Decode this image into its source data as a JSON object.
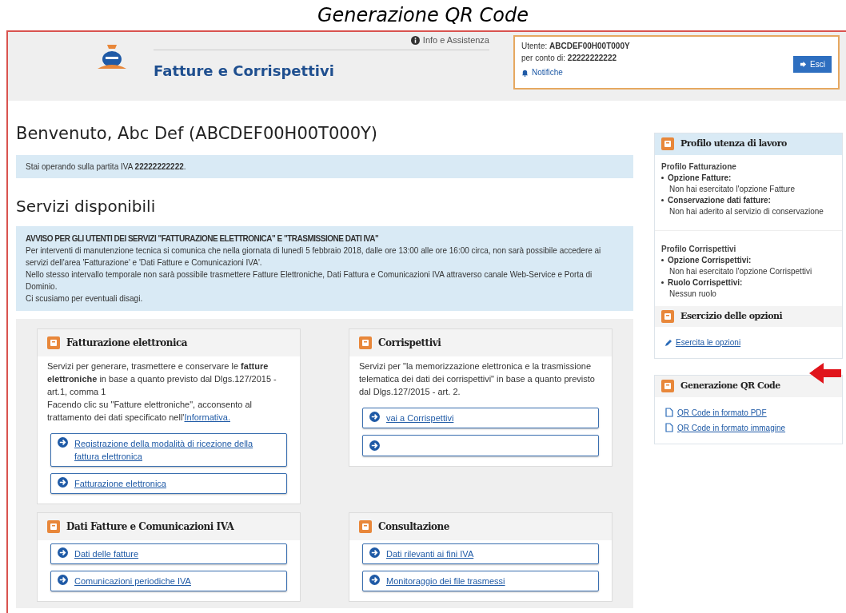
{
  "caption": "Generazione QR Code",
  "header": {
    "info_link": "Info e Assistenza",
    "app_title": "Fatture e Corrispettivi",
    "user_label": "Utente:",
    "user_value": "ABCDEF00H00T000Y",
    "account_label": "per conto di:",
    "account_value": "22222222222",
    "notifications": "Notifiche",
    "logout_button": "Esci"
  },
  "welcome": "Benvenuto, Abc Def (ABCDEF00H00T000Y)",
  "vat_notice": "Stai operando sulla partita IVA **22222222222**.",
  "services_title": "Servizi disponibili",
  "notice": {
    "title": "AVVISO PER GLI UTENTI DEI SERVIZI \"FATTURAZIONE ELETTRONICA\" E \"TRASMISSIONE DATI IVA\"",
    "lines": [
      "Per interventi di manutenzione tecnica si comunica che nella giornata di lunedì 5 febbraio 2018, dalle ore 13:00 alle ore 16:00 circa, non sarà possibile accedere ai servizi dell'area 'Fatturazione' e 'Dati Fatture e Comunicazioni IVA'.",
      "Nello stesso intervallo temporale non sarà possibile trasmettere Fatture Elettroniche, Dati Fattura e Comunicazioni IVA attraverso canale Web-Service e Porta di Dominio.",
      "Ci scusiamo per eventuali disagi."
    ]
  },
  "services": [
    {
      "title": "Fatturazione elettronica",
      "description": [
        {
          "text": "Servizi per generare, trasmettere e conservare le **fatture elettroniche** in base a quanto previsto dal Dlgs.127/2015 - art.1, comma 1"
        },
        {
          "text": "Facendo clic su \"Fatture elettroniche\", acconsento al trattamento dei dati specificato nell'",
          "link": "Informativa."
        }
      ],
      "links": [
        {
          "kind": "text",
          "label": "Registrazione della modalità di ricezione della fattura elettronica"
        },
        {
          "kind": "text",
          "label": "Fatturazione elettronica"
        }
      ]
    },
    {
      "title": "Corrispettivi",
      "description": [
        {
          "text": "Servizi per \"la memorizzazione elettronica e la trasmissione telematica dei dati dei corrispettivi\" in base a quanto previsto dal Dlgs.127/2015 - art. 2."
        }
      ],
      "links": [
        {
          "kind": "text",
          "label": "vai a Corrispettivi"
        },
        {
          "kind": "icon_only"
        }
      ]
    },
    {
      "title": "Dati Fatture e Comunicazioni IVA",
      "links": [
        {
          "kind": "text",
          "label": "Dati delle fatture"
        },
        {
          "kind": "text",
          "label": "Comunicazioni periodiche IVA"
        }
      ]
    },
    {
      "title": "Consultazione",
      "links": [
        {
          "kind": "text",
          "label": "Dati rilevanti ai fini IVA"
        },
        {
          "kind": "text",
          "label": "Monitoraggio dei file trasmessi"
        }
      ]
    }
  ],
  "profile_panel": {
    "title": "Profilo utenza di lavoro",
    "sections": [
      {
        "title": "Profilo Fatturazione",
        "items": [
          {
            "label": "Opzione Fatture:",
            "value": "Non hai esercitato l'opzione Fatture"
          },
          {
            "label": "Conservazione dati fatture:",
            "value": "Non hai aderito al servizio di conservazione"
          }
        ]
      },
      {
        "title": "Profilo Corrispettivi",
        "items": [
          {
            "label": "Opzione Corrispettivi:",
            "value": "Non hai esercitato l'opzione Corrispettivi"
          },
          {
            "label": "Ruolo Corrispettivi:",
            "value": "Nessun ruolo"
          }
        ]
      }
    ],
    "options_title": "Esercizio delle opzioni",
    "options_link": "Esercita le opzioni"
  },
  "qr_panel": {
    "title": "Generazione QR Code",
    "links": [
      "QR Code in formato PDF",
      "QR Code in formato immagine"
    ]
  }
}
